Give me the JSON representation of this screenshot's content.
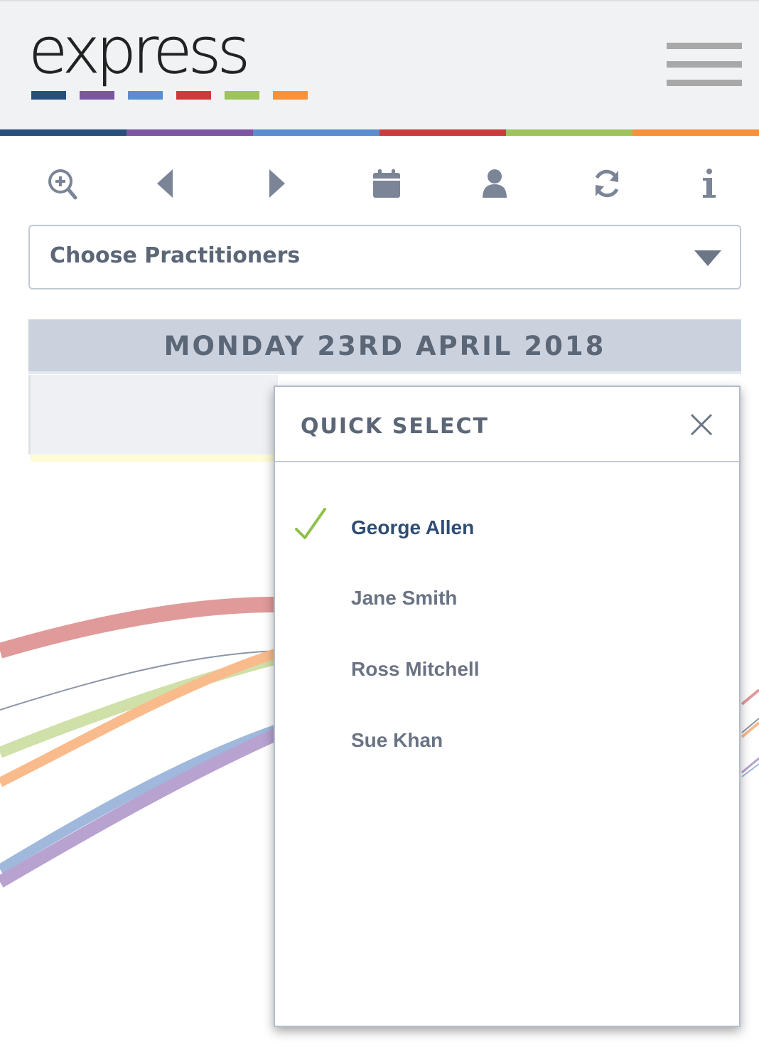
{
  "header": {
    "logo_text": "express",
    "logo_bar_colors": [
      "#264f7e",
      "#7a56a3",
      "#5a8ed0",
      "#cc3b3b",
      "#9fc35b",
      "#f7913a"
    ],
    "rainbow_colors": [
      "#264f7e",
      "#7a56a3",
      "#5a8ed0",
      "#cc3b3b",
      "#9fc35b",
      "#f7913a"
    ],
    "menu_icon": "hamburger-menu-icon"
  },
  "toolbar": {
    "icons": [
      "zoom-in-icon",
      "chevron-left-icon",
      "chevron-right-icon",
      "calendar-icon",
      "user-icon",
      "refresh-icon",
      "info-icon"
    ],
    "icon_color": "#7b8597"
  },
  "practitioner_select": {
    "label": "Choose Practitioners"
  },
  "calendar": {
    "date_heading": "MONDAY 23RD APRIL 2018"
  },
  "quick_select": {
    "title": "QUICK SELECT",
    "items": [
      {
        "label": "George Allen",
        "selected": true
      },
      {
        "label": "Jane Smith",
        "selected": false
      },
      {
        "label": "Ross Mitchell",
        "selected": false
      },
      {
        "label": "Sue Khan",
        "selected": false
      }
    ],
    "check_color": "#8fc04a"
  }
}
